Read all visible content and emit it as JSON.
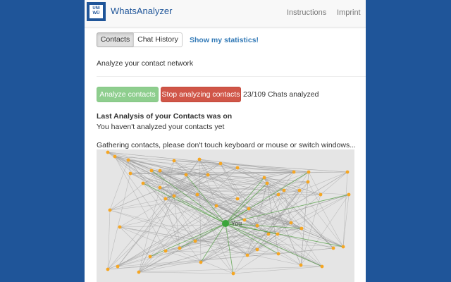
{
  "navbar": {
    "logo_text": "UNI WÜ",
    "brand": "WhatsAnalyzer",
    "links": [
      "Instructions",
      "Imprint"
    ]
  },
  "tabs": [
    {
      "label": "Contacts",
      "active": true
    },
    {
      "label": "Chat History",
      "active": false
    }
  ],
  "stats_link": "Show my statistics!",
  "subtitle": "Analyze your contact network",
  "buttons": {
    "analyze": "Analyze contacts",
    "stop": "Stop analyzing contacts"
  },
  "chat_count": "23/109 Chats analyzed",
  "last_analysis": {
    "title": "Last Analysis of your Contacts was on",
    "text": "You haven't analyzed your contacts yet"
  },
  "gathering_text": "Gathering contacts, please don't touch keyboard or mouse or switch windows...",
  "graph": {
    "center_label": "You",
    "colors": {
      "background": "#e5e5e5",
      "node": "#f5a623",
      "center_node": "#3aa53a",
      "edge": "#9a9a9a",
      "center_edge": "#4a9a3a",
      "analyze_button": "#8ece8e",
      "stop_button": "#d05648",
      "link": "#337ab7",
      "brand": "#1f5599"
    }
  }
}
